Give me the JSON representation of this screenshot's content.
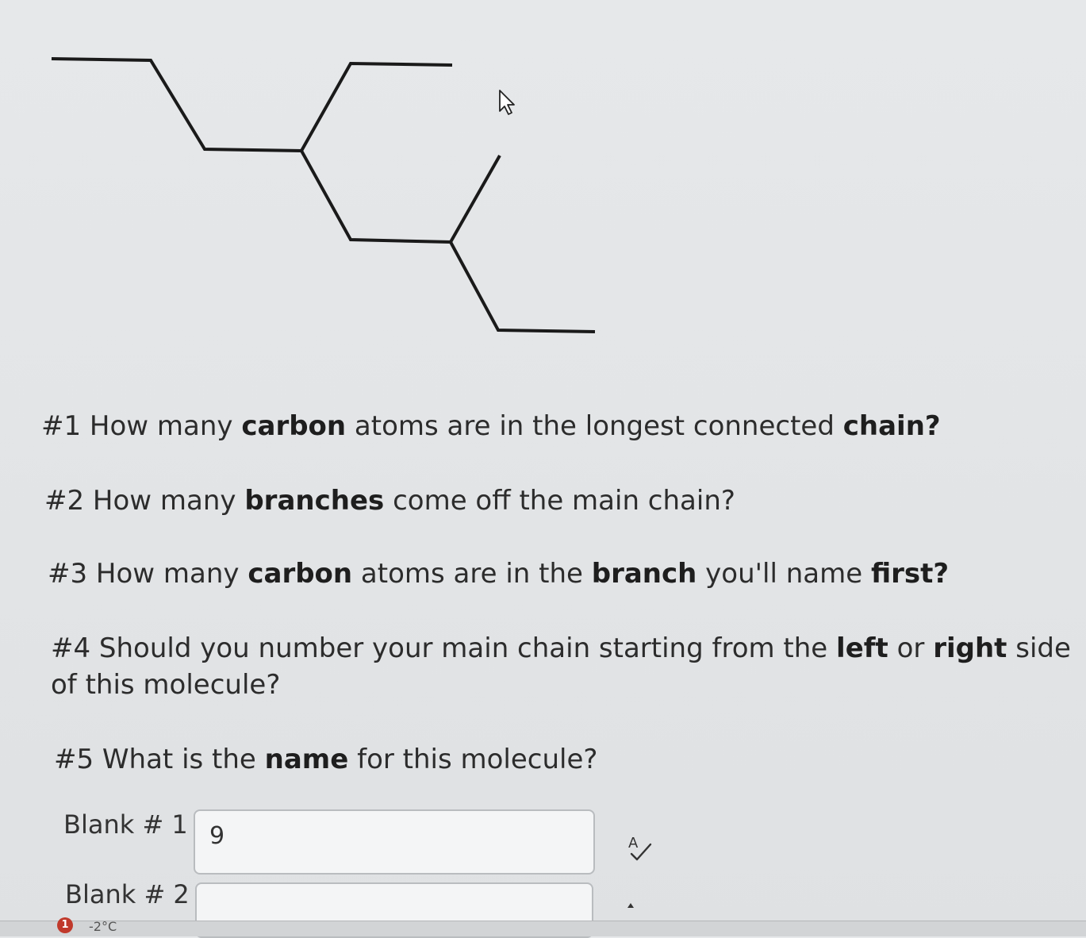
{
  "questions": [
    {
      "id": "q1",
      "parts": [
        {
          "text": "#1 How many ",
          "bold": false
        },
        {
          "text": "carbon",
          "bold": true
        },
        {
          "text": " atoms are in the longest connected ",
          "bold": false
        },
        {
          "text": "chain?",
          "bold": true
        }
      ]
    },
    {
      "id": "q2",
      "parts": [
        {
          "text": "#2 How many ",
          "bold": false
        },
        {
          "text": "branches",
          "bold": true
        },
        {
          "text": " come off the main chain?",
          "bold": false
        }
      ]
    },
    {
      "id": "q3",
      "parts": [
        {
          "text": "#3 How many ",
          "bold": false
        },
        {
          "text": "carbon",
          "bold": true
        },
        {
          "text": " atoms are in the ",
          "bold": false
        },
        {
          "text": "branch",
          "bold": true
        },
        {
          "text": " you'll name ",
          "bold": false
        },
        {
          "text": "first?",
          "bold": true
        }
      ]
    },
    {
      "id": "q4",
      "parts": [
        {
          "text": "#4 Should you number your main chain starting from the ",
          "bold": false
        },
        {
          "text": "left",
          "bold": true
        },
        {
          "text": " or ",
          "bold": false
        },
        {
          "text": "right",
          "bold": true
        },
        {
          "text": " side of this molecule?",
          "bold": false
        }
      ]
    },
    {
      "id": "q5",
      "parts": [
        {
          "text": "#5 What is the ",
          "bold": false
        },
        {
          "text": "name",
          "bold": true
        },
        {
          "text": " for this molecule?",
          "bold": false
        }
      ]
    }
  ],
  "blanks": [
    {
      "label": "Blank # 1",
      "value": "9"
    },
    {
      "label": "Blank # 2",
      "value": ""
    }
  ],
  "taskbar": {
    "notification_count": "1",
    "temperature": "-2°C"
  },
  "icons": {
    "cursor": "mouse-pointer-icon",
    "spellcheck": "spellcheck-icon"
  }
}
